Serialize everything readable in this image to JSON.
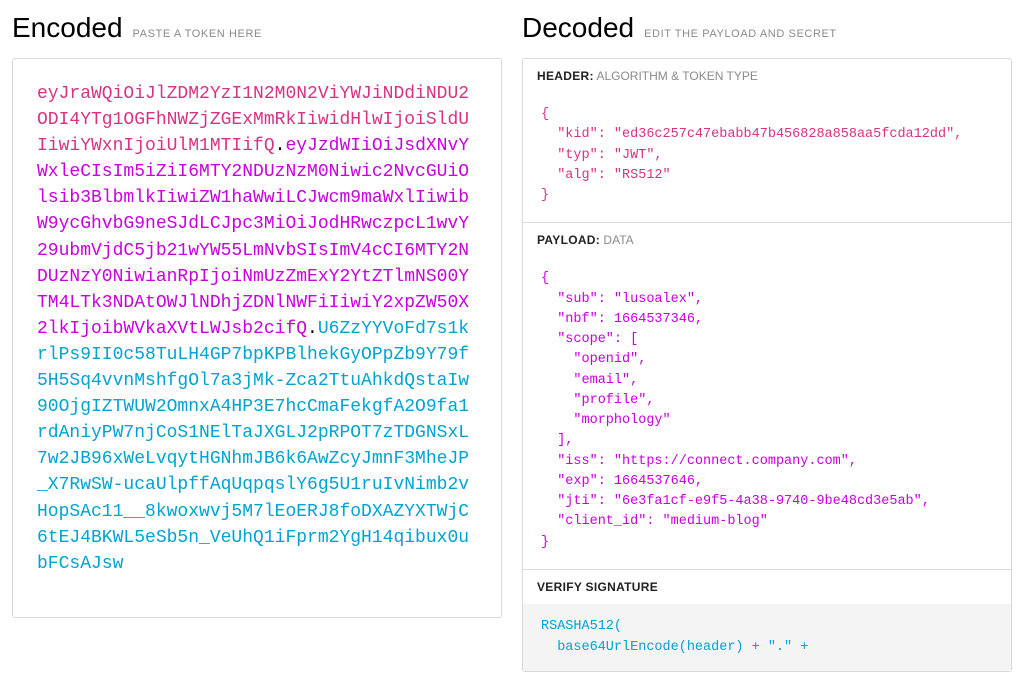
{
  "encoded": {
    "title": "Encoded",
    "subtitle": "PASTE A TOKEN HERE",
    "token_header": "eyJraWQiOiJlZDM2YzI1N2M0N2ViYWJiNDdiNDU2ODI4YTg1OGFhNWZjZGExMmRkIiwidHlwIjoiSldUIiwiYWxnIjoiUlM1MTIifQ",
    "token_payload": "eyJzdWIiOiJsdXNvYWxleCIsIm5iZiI6MTY2NDUzNzM0Niwic2NvcGUiOlsib3BlbmlkIiwiZW1haWwiLCJwcm9maWxlIiwibW9ycGhvbG9neSJdLCJpc3MiOiJodHRwczpcL1wvY29ubmVjdC5jb21wYW55LmNvbSIsImV4cCI6MTY2NDUzNzY0NiwianRpIjoiNmUzZmExY2YtZTlmNS00YTM4LTk3NDAtOWJlNDhjZDNlNWFiIiwiY2xpZW50X2lkIjoibWVkaXVtLWJsb2cifQ",
    "token_signature": "U6ZzYYVoFd7s1krlPs9II0c58TuLH4GP7bpKPBlhekGyOPpZb9Y79f5H5Sq4vvnMshfgOl7a3jMk-Zca2TtuAhkdQstaIw90OjgIZTWUW2OmnxA4HP3E7hcCmaFekgfA2O9fa1rdAniyPW7njCoS1NElTaJXGLJ2pRPOT7zTDGNSxL7w2JB96xWeLvqytHGNhmJB6k6AwZcyJmnF3MheJP_X7RwSW-ucaUlpffAqUqpqslY6g5U1ruIvNimb2vHopSAc11__8kwoxwvj5M7lEoERJ8foDXAZYXTWjC6tEJ4BKWL5eSb5n_VeUhQ1iFprm2YgH14qibux0ubFCsAJsw"
  },
  "decoded": {
    "title": "Decoded",
    "subtitle": "EDIT THE PAYLOAD AND SECRET",
    "header_section": {
      "label": "HEADER:",
      "meta": "ALGORITHM & TOKEN TYPE",
      "json": "{\n  \"kid\": \"ed36c257c47ebabb47b456828a858aa5fcda12dd\",\n  \"typ\": \"JWT\",\n  \"alg\": \"RS512\"\n}"
    },
    "payload_section": {
      "label": "PAYLOAD:",
      "meta": "DATA",
      "json": "{\n  \"sub\": \"lusoalex\",\n  \"nbf\": 1664537346,\n  \"scope\": [\n    \"openid\",\n    \"email\",\n    \"profile\",\n    \"morphology\"\n  ],\n  \"iss\": \"https://connect.company.com\",\n  \"exp\": 1664537646,\n  \"jti\": \"6e3fa1cf-e9f5-4a38-9740-9be48cd3e5ab\",\n  \"client_id\": \"medium-blog\"\n}"
    },
    "signature_section": {
      "label": "VERIFY SIGNATURE",
      "body": "RSASHA512(\n  base64UrlEncode(header) + \".\" +"
    }
  },
  "chart_data": {
    "type": "table",
    "title": "JWT header and payload",
    "header": {
      "kid": "ed36c257c47ebabb47b456828a858aa5fcda12dd",
      "typ": "JWT",
      "alg": "RS512"
    },
    "payload": {
      "sub": "lusoalex",
      "nbf": 1664537346,
      "scope": [
        "openid",
        "email",
        "profile",
        "morphology"
      ],
      "iss": "https://connect.company.com",
      "exp": 1664537646,
      "jti": "6e3fa1cf-e9f5-4a38-9740-9be48cd3e5ab",
      "client_id": "medium-blog"
    }
  }
}
